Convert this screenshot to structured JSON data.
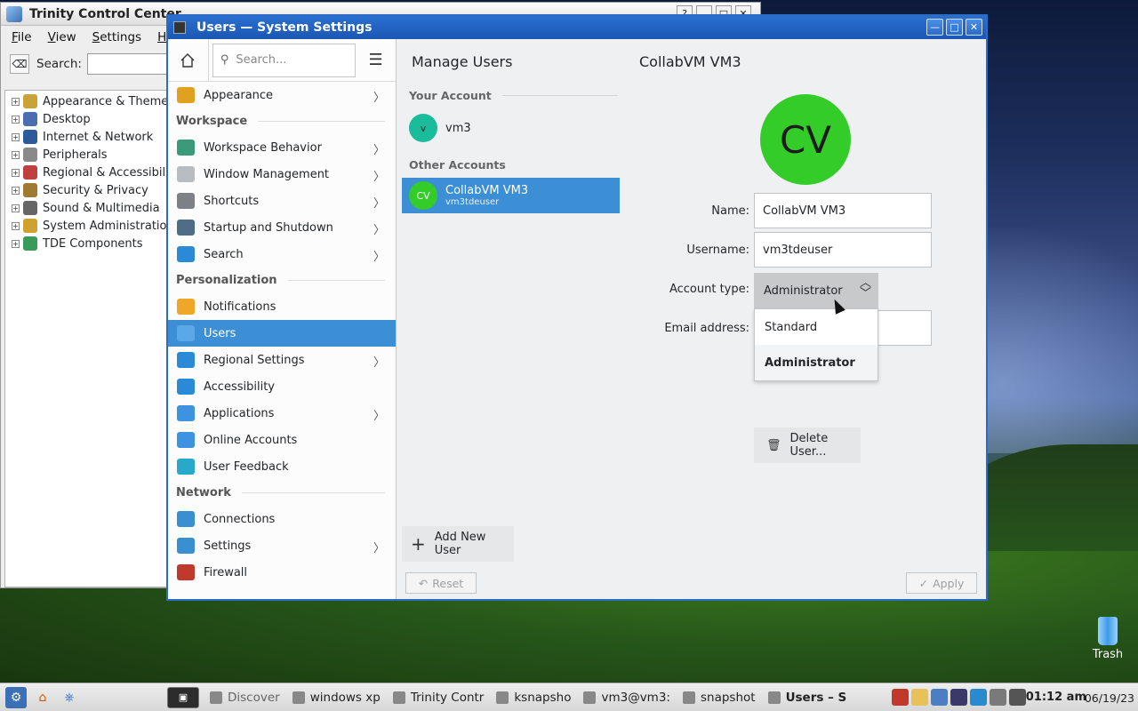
{
  "trinity": {
    "title": "Trinity Control Center",
    "buttons": [
      "?",
      "_",
      "□",
      "✕"
    ],
    "menu": [
      "File",
      "View",
      "Settings",
      "Help"
    ],
    "search_label": "Search:",
    "tree": [
      {
        "label": "Appearance & Themes",
        "color": "#c9a337"
      },
      {
        "label": "Desktop",
        "color": "#4a6fb0"
      },
      {
        "label": "Internet & Network",
        "color": "#2c5a9a"
      },
      {
        "label": "Peripherals",
        "color": "#8a8a8a"
      },
      {
        "label": "Regional & Accessibility",
        "color": "#c04040"
      },
      {
        "label": "Security & Privacy",
        "color": "#a07a30"
      },
      {
        "label": "Sound & Multimedia",
        "color": "#666666"
      },
      {
        "label": "System Administration",
        "color": "#d0a030"
      },
      {
        "label": "TDE Components",
        "color": "#3a9a5a"
      }
    ]
  },
  "settings": {
    "window_title": "Users  — System Settings",
    "search_placeholder": "Search...",
    "sidebar": {
      "top": [
        {
          "label": "Appearance",
          "color": "#e0a020",
          "chevron": true
        }
      ],
      "workspace_label": "Workspace",
      "workspace": [
        {
          "label": "Workspace Behavior",
          "color": "#3b9a7a",
          "chevron": true
        },
        {
          "label": "Window Management",
          "color": "#b9bdc2",
          "chevron": true
        },
        {
          "label": "Shortcuts",
          "color": "#7d8085",
          "chevron": true
        },
        {
          "label": "Startup and Shutdown",
          "color": "#4f6d86",
          "chevron": true
        },
        {
          "label": "Search",
          "color": "#2b8ad6",
          "chevron": true
        }
      ],
      "personalization_label": "Personalization",
      "personalization": [
        {
          "label": "Notifications",
          "color": "#f0a628",
          "chevron": false
        },
        {
          "label": "Users",
          "color": "#5aa8e8",
          "chevron": false,
          "active": true
        },
        {
          "label": "Regional Settings",
          "color": "#2b8ad6",
          "chevron": true
        },
        {
          "label": "Accessibility",
          "color": "#2b8ad6",
          "chevron": false
        },
        {
          "label": "Applications",
          "color": "#3e93e0",
          "chevron": true
        },
        {
          "label": "Online Accounts",
          "color": "#3e93e0",
          "chevron": false
        },
        {
          "label": "User Feedback",
          "color": "#28a9c9",
          "chevron": false
        }
      ],
      "network_label": "Network",
      "network": [
        {
          "label": "Connections",
          "color": "#3a8fd0",
          "chevron": false
        },
        {
          "label": "Settings",
          "color": "#3a8fd0",
          "chevron": true
        },
        {
          "label": "Firewall",
          "color": "#c0392b",
          "chevron": false
        }
      ]
    },
    "accounts": {
      "header": "Manage Users",
      "your_account_label": "Your Account",
      "your_account": {
        "initials": "v",
        "name": "vm3",
        "color": "#1abc9c"
      },
      "other_accounts_label": "Other Accounts",
      "other": {
        "initials": "CV",
        "name": "CollabVM VM3",
        "username": "vm3tdeuser",
        "color": "#33cc29"
      },
      "add_user": "Add New User",
      "reset": "Reset"
    },
    "detail": {
      "header": "CollabVM VM3",
      "initials": "CV",
      "name_label": "Name:",
      "name_value": "CollabVM VM3",
      "username_label": "Username:",
      "username_value": "vm3tdeuser",
      "account_type_label": "Account type:",
      "account_type_value": "Administrator",
      "options": [
        "Standard",
        "Administrator"
      ],
      "email_label": "Email address:",
      "delete": "Delete User...",
      "apply": "Apply"
    }
  },
  "desktop": {
    "trash_label": "Trash"
  },
  "taskbar": {
    "tasks": [
      {
        "label": "Discover",
        "dim": true
      },
      {
        "label": "windows xp",
        "dim": false
      },
      {
        "label": "Trinity Contr",
        "dim": false
      },
      {
        "label": "ksnapsho",
        "dim": false
      },
      {
        "label": "vm3@vm3:",
        "dim": false
      },
      {
        "label": "snapshot",
        "dim": false
      },
      {
        "label": "Users – S",
        "dim": false,
        "current": true
      }
    ],
    "time": "01:12 am",
    "date": "06/19/23"
  }
}
